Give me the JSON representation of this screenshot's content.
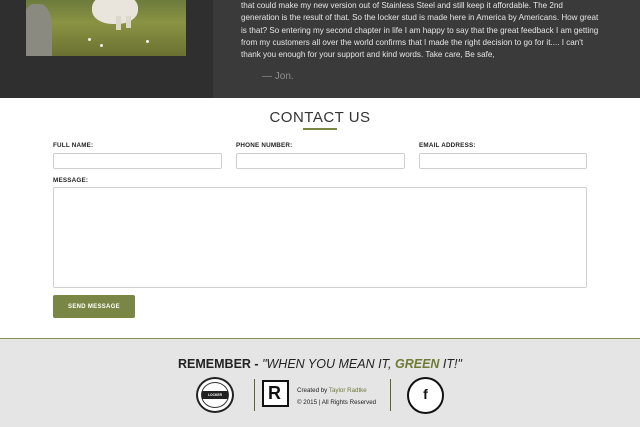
{
  "testimonial": {
    "lines": [
      "that could make my new version out of Stainless Steel and still keep it affordable. The 2nd",
      "generation is the result of that. So the locker stud is made here in America by Americans. How great",
      "is that? So entering my second chapter in life I am happy to say that the great feedback I am getting",
      "from my customers all over the world confirms that I made the right decision to go for it.... I can't",
      "thank you enough for your support and kind words. Take care, Be safe,"
    ],
    "author": "— Jon."
  },
  "contact": {
    "title": "CONTACT US",
    "full_name_label": "FULL NAME:",
    "phone_label": "PHONE NUMBER:",
    "email_label": "EMAIL ADDRESS:",
    "message_label": "MESSAGE:",
    "full_name_value": "",
    "phone_value": "",
    "email_value": "",
    "message_value": "",
    "send_label": "SEND MESSAGE"
  },
  "footer": {
    "remember_lead": "REMEMBER - ",
    "remember_quote_open": "\"WHEN YOU MEAN IT, ",
    "remember_green": "GREEN",
    "remember_quote_close": " IT!\"",
    "badge_text": "LOCKER",
    "rlogo_letter": "R",
    "credit_prefix": "Created by ",
    "credit_name": "Taylor Radtke",
    "copyright": "© 2015 | All Rights Reserved",
    "facebook_glyph": "f"
  },
  "colors": {
    "accent_green": "#7a8645",
    "dark_band": "#3a3a3a",
    "footer_bg": "#e5e5e5"
  },
  "icons": [
    "photo",
    "locker-badge-logo",
    "r-logo",
    "facebook-icon"
  ]
}
